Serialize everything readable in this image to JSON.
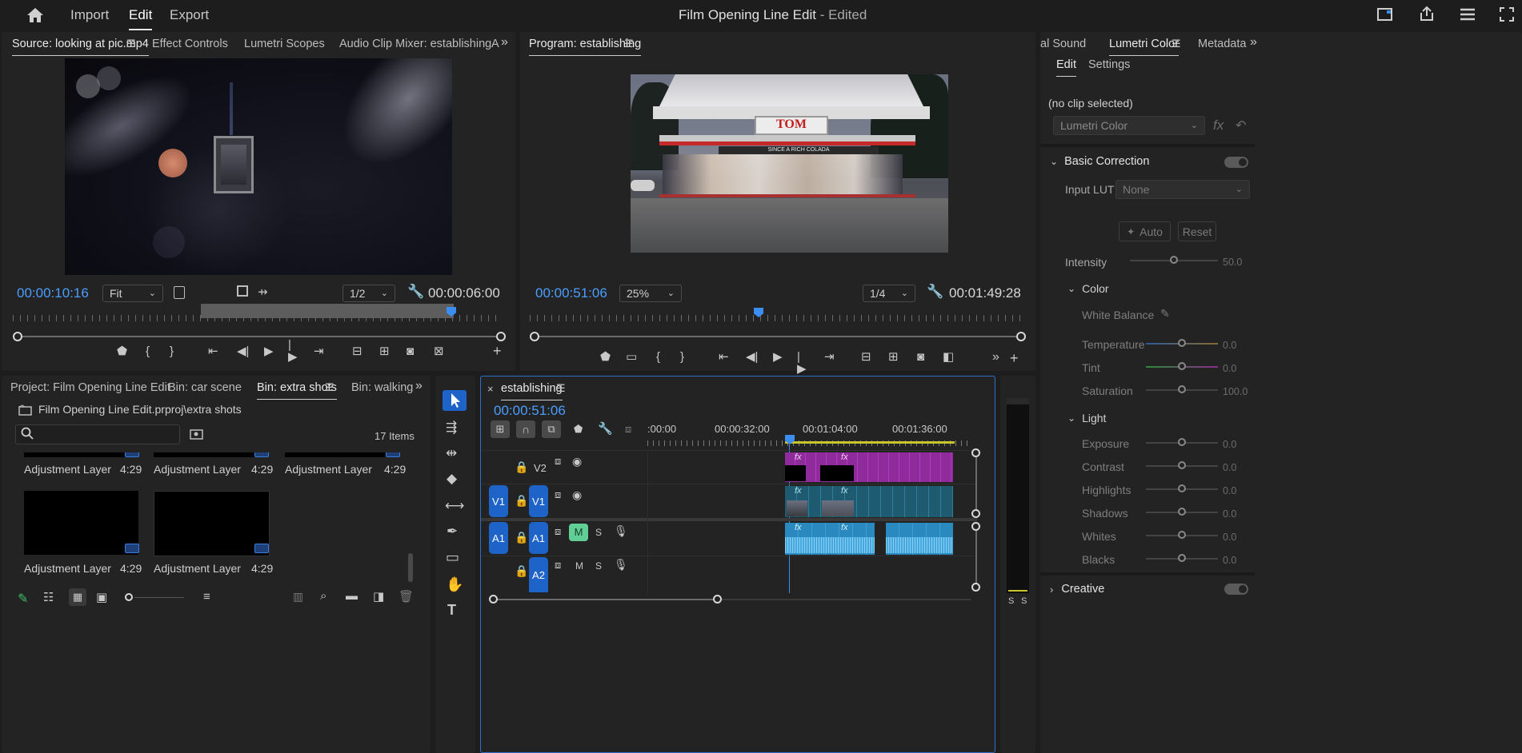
{
  "menu": {
    "import": "Import",
    "edit": "Edit",
    "export": "Export"
  },
  "window": {
    "title": "Film Opening Line Edit",
    "status": " - Edited"
  },
  "source_monitor": {
    "tabs": [
      "Source: looking at pic.mp4",
      "Effect Controls",
      "Lumetri Scopes",
      "Audio Clip Mixer: establishing",
      "A"
    ],
    "timecode": "00:00:10:16",
    "fit": "Fit",
    "resolution": "1/2",
    "duration": "00:00:06:00"
  },
  "program_monitor": {
    "tab": "Program: establishing",
    "timecode": "00:00:51:06",
    "zoom": "25%",
    "resolution": "1/4",
    "duration": "00:01:49:28",
    "sign_text": "TOM",
    "banner_text": "SINCE A RICH COLADA"
  },
  "project": {
    "tabs": [
      "Project: Film Opening Line Edit",
      "Bin: car scene",
      "Bin: extra shots",
      "Bin: walking o"
    ],
    "path": "Film Opening Line Edit.prproj\\extra shots",
    "search_placeholder": "",
    "items_count": "17 Items",
    "items": [
      {
        "name": "Adjustment Layer",
        "duration": "4:29"
      },
      {
        "name": "Adjustment Layer",
        "duration": "4:29"
      },
      {
        "name": "Adjustment Layer",
        "duration": "4:29"
      },
      {
        "name": "Adjustment Layer",
        "duration": "4:29"
      },
      {
        "name": "Adjustment Layer",
        "duration": "4:29"
      }
    ]
  },
  "timeline": {
    "tab": "establishing",
    "timecode": "00:00:51:06",
    "ruler": [
      ":00:00",
      "00:00:32:00",
      "00:01:04:00",
      "00:01:36:00"
    ],
    "tracks": {
      "v2": "V2",
      "v1_src": "V1",
      "v1": "V1",
      "a1_src": "A1",
      "a1": "A1",
      "a2": "A2",
      "m": "M",
      "s": "S",
      "fx": "fx"
    },
    "meter_labels": [
      "S",
      "S"
    ]
  },
  "lumetri": {
    "tabs": [
      "al Sound",
      "Lumetri Color",
      "Metadata"
    ],
    "subtabs": [
      "Edit",
      "Settings"
    ],
    "no_clip": "(no clip selected)",
    "effect_dropdown": "Lumetri Color",
    "basic_correction": "Basic Correction",
    "input_lut_label": "Input LUT",
    "input_lut_value": "None",
    "auto": "Auto",
    "reset": "Reset",
    "intensity": {
      "label": "Intensity",
      "value": "50.0"
    },
    "color_section": "Color",
    "white_balance": "White Balance",
    "color_controls": [
      {
        "label": "Temperature",
        "value": "0.0"
      },
      {
        "label": "Tint",
        "value": "0.0"
      },
      {
        "label": "Saturation",
        "value": "100.0"
      }
    ],
    "light_section": "Light",
    "light_controls": [
      {
        "label": "Exposure",
        "value": "0.0"
      },
      {
        "label": "Contrast",
        "value": "0.0"
      },
      {
        "label": "Highlights",
        "value": "0.0"
      },
      {
        "label": "Shadows",
        "value": "0.0"
      },
      {
        "label": "Whites",
        "value": "0.0"
      },
      {
        "label": "Blacks",
        "value": "0.0"
      }
    ],
    "creative": "Creative"
  }
}
